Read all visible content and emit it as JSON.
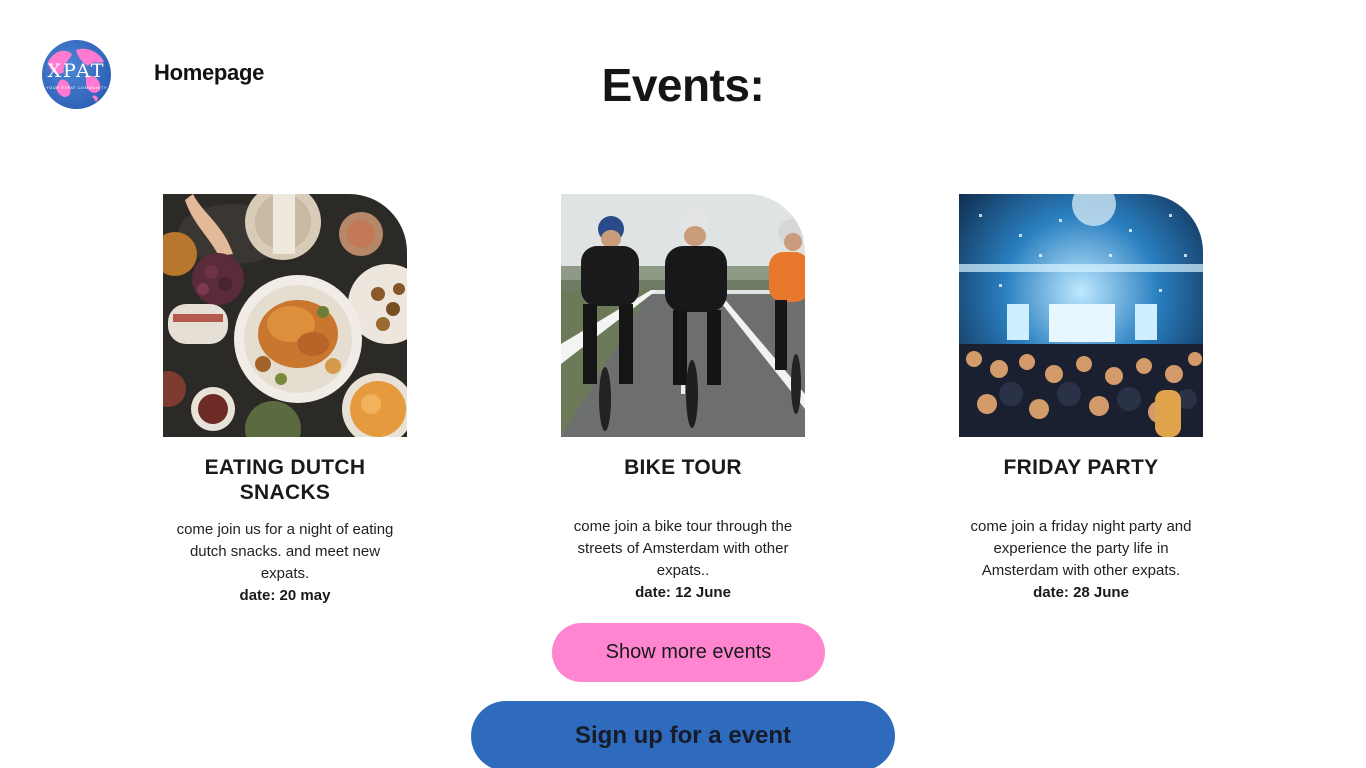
{
  "logo": {
    "text": "XPAT",
    "subtext": "YOUR EXPAT COMMUNITY",
    "icon": "globe-logo-icon"
  },
  "nav": {
    "home_label": "Homepage"
  },
  "page": {
    "title": "Events:"
  },
  "events": [
    {
      "title": "EATING DUTCH SNACKS",
      "description": "come join us for a night of eating dutch snacks. and meet new expats.",
      "date": "date: 20 may",
      "image": "food-table-image"
    },
    {
      "title": "BIKE TOUR",
      "description": "come join a bike tour through the streets of Amsterdam with other expats..",
      "date": "date: 12 June",
      "image": "cyclists-image"
    },
    {
      "title": "FRIDAY PARTY",
      "description": "come join a friday night party and experience the party life in Amsterdam with other expats.",
      "date": "date: 28 June",
      "image": "party-crowd-image"
    }
  ],
  "buttons": {
    "show_more": "Show more events",
    "sign_up": "Sign up for a event"
  },
  "colors": {
    "pink_accent": "#ff85d0",
    "blue_accent": "#2f6bbd",
    "logo_blue": "#2f63b8",
    "logo_pink": "#ff7ad0"
  }
}
